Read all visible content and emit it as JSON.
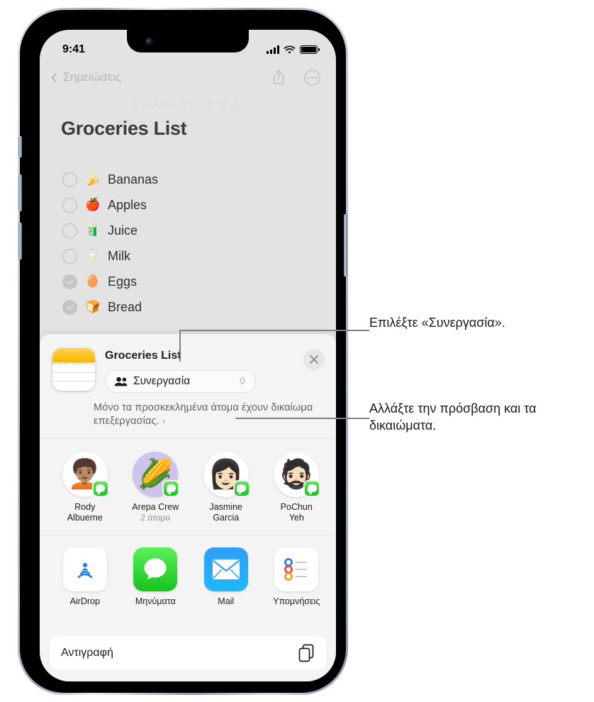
{
  "status_bar": {
    "time": "9:41"
  },
  "nav": {
    "back_label": "Σημειώσεις",
    "share_icon": "share-icon",
    "more_icon": "more-ellipsis-icon",
    "date_ghost": "8 Ιουνίου 2022, 8:39 μμ"
  },
  "note": {
    "title": "Groceries List",
    "items": [
      {
        "emoji": "🍌",
        "label": "Bananas",
        "checked": false
      },
      {
        "emoji": "🍎",
        "label": "Apples",
        "checked": false
      },
      {
        "emoji": "🧃",
        "label": "Juice",
        "checked": false
      },
      {
        "emoji": "🥛",
        "label": "Milk",
        "checked": false
      },
      {
        "emoji": "🥚",
        "label": "Eggs",
        "checked": true
      },
      {
        "emoji": "🍞",
        "label": "Bread",
        "checked": true
      }
    ]
  },
  "share_sheet": {
    "doc_title": "Groceries List",
    "app_icon": "notes-app-icon",
    "close_icon": "close-x-icon",
    "collaborate": {
      "label": "Συνεργασία",
      "icon": "two-people-icon",
      "selector_icon": "up-down-chevron-icon"
    },
    "permission_text": "Μόνο τα προσκεκλημένα άτομα έχουν δικαίωμα επεξεργασίας.",
    "permission_arrow": "›",
    "contacts": [
      {
        "name_line1": "Rody",
        "name_line2": "Albuerne",
        "sub": "",
        "avatar": "memoji-green-beanie",
        "emoji": "🧑🏽‍🦱",
        "badge": "messages-badge"
      },
      {
        "name_line1": "Arepa Crew",
        "name_line2": "",
        "sub": "2 άτομα",
        "avatar": "corn-emoji-group",
        "emoji": "🌽",
        "badge": "messages-badge"
      },
      {
        "name_line1": "Jasmine",
        "name_line2": "Garcia",
        "sub": "",
        "avatar": "memoji-glasses",
        "emoji": "👩🏻",
        "badge": "messages-badge"
      },
      {
        "name_line1": "PoChun",
        "name_line2": "Yeh",
        "sub": "",
        "avatar": "memoji-beard",
        "emoji": "🧔🏻",
        "badge": "messages-badge"
      }
    ],
    "apps": [
      {
        "label": "AirDrop",
        "icon": "airdrop-icon"
      },
      {
        "label": "Μηνύματα",
        "icon": "messages-icon"
      },
      {
        "label": "Mail",
        "icon": "mail-icon"
      },
      {
        "label": "Υπομνήσεις",
        "icon": "reminders-icon"
      }
    ],
    "copy_row": {
      "label": "Αντιγραφή",
      "icon": "copy-pages-icon"
    }
  },
  "callouts": [
    {
      "text": "Επιλέξτε «Συνεργασία»."
    },
    {
      "text": "Αλλάξτε την πρόσβαση και τα δικαιώματα."
    }
  ],
  "colors": {
    "accent_green": "#17c31d",
    "notes_yellow": "#f6b800",
    "mail_blue": "#2f9ff5",
    "leader_gray": "#808080",
    "screen_bg": "#e3e3e3",
    "sheet_bg": "#f4f4f5"
  }
}
